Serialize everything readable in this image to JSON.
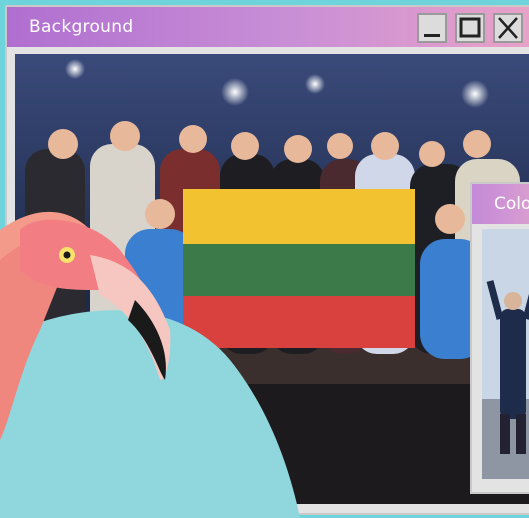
{
  "main_window": {
    "title": "Background",
    "controls": {
      "minimize": "minimize-icon",
      "maximize": "maximize-icon",
      "close": "close-icon"
    },
    "photo": "group-photo-with-lithuanian-flag"
  },
  "second_window": {
    "title": "Colo",
    "photo": "person-outdoors-arms-raised"
  },
  "decoration": "flamingo-illustration",
  "colors": {
    "desktop": "#6fd3dc",
    "titlebar_start": "#b06fd0",
    "titlebar_end": "#e8a2c8",
    "flag_yellow": "#f2c230",
    "flag_green": "#3c7a4a",
    "flag_red": "#d8413d"
  }
}
